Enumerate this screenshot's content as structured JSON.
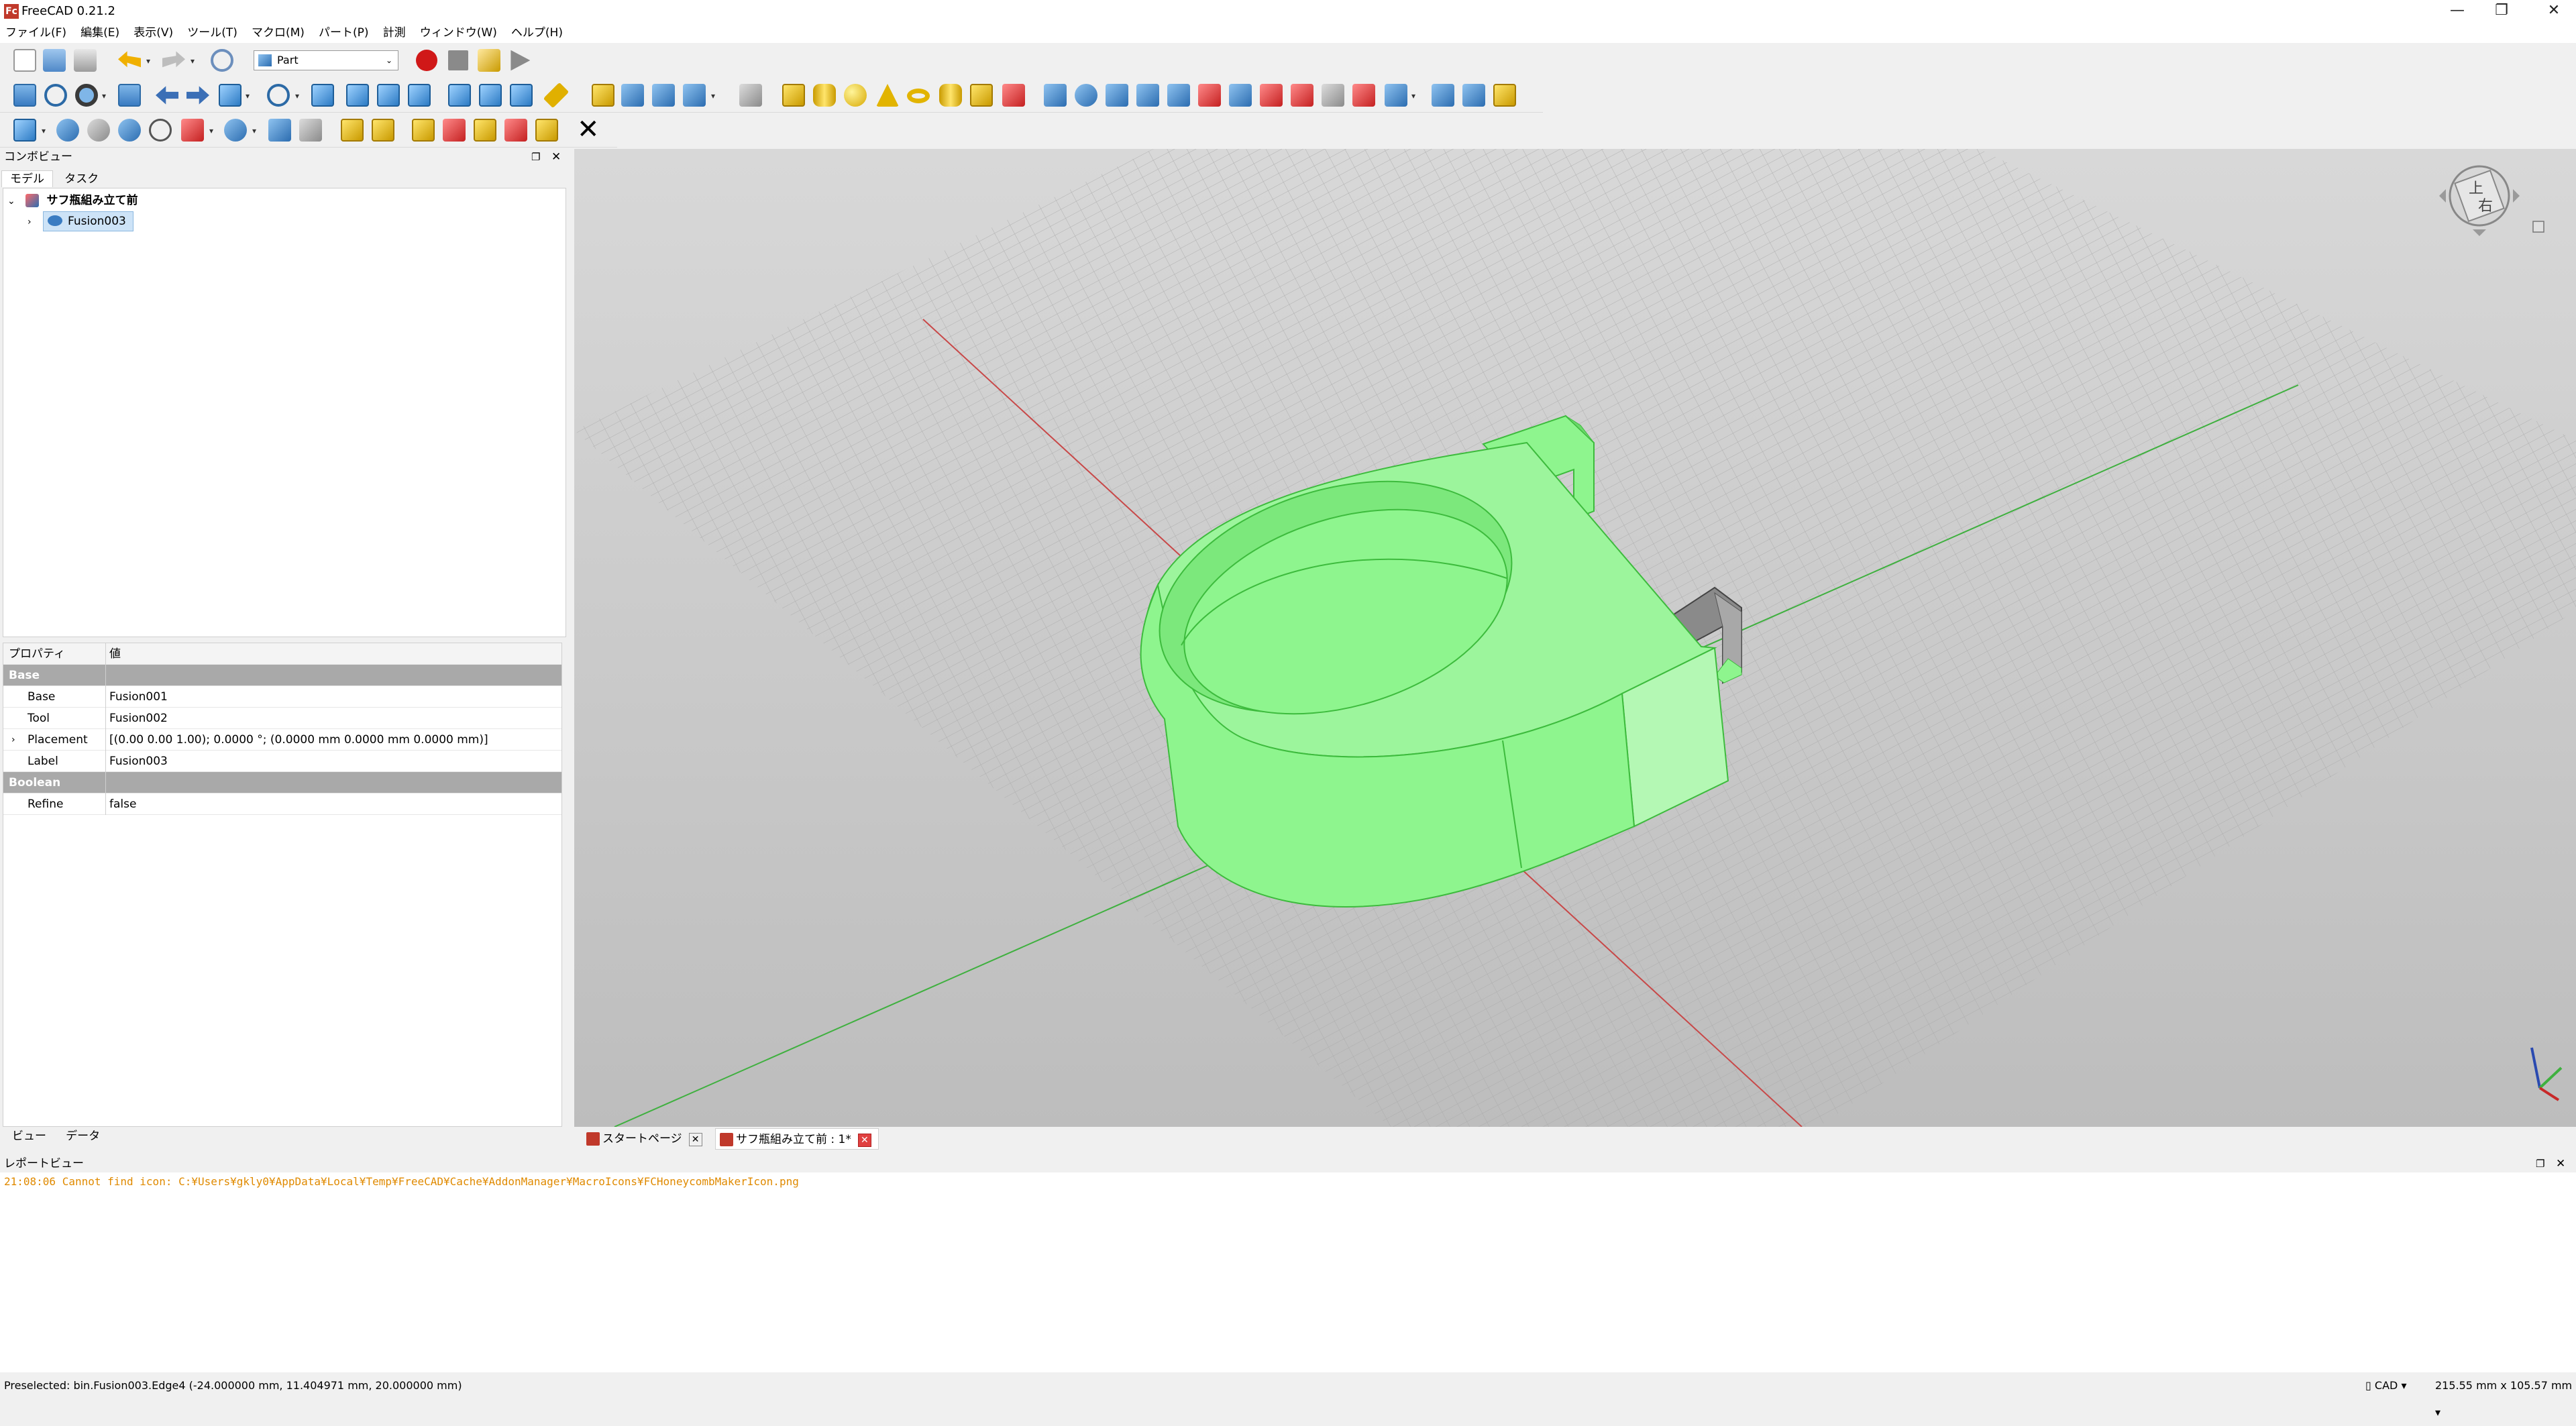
{
  "app": {
    "title": "FreeCAD 0.21.2",
    "logo_text": "Fc",
    "window_buttons": {
      "minimize": "—",
      "restore": "❐",
      "close": "✕"
    }
  },
  "menu": [
    "ファイル(F)",
    "編集(E)",
    "表示(V)",
    "ツール(T)",
    "マクロ(M)",
    "パート(P)",
    "計測",
    "ウィンドウ(W)",
    "ヘルプ(H)"
  ],
  "toolbar": {
    "workbench": "Part",
    "icons": [
      "new-file-icon",
      "open-icon",
      "save-icon",
      "undo-icon",
      "redo-icon",
      "refresh-icon",
      "record-macro-icon",
      "stop-macro-icon",
      "macros-icon",
      "execute-macro-icon",
      "fit-all-icon",
      "fit-selection-icon",
      "draw-style-icon",
      "bounding-box-icon",
      "back-icon",
      "forward-icon",
      "std-views-icon",
      "zoom-icon",
      "isometric-icon",
      "front-icon",
      "top-icon",
      "right-icon",
      "rear-icon",
      "bottom-icon",
      "left-icon",
      "measure-icon"
    ]
  },
  "combo": {
    "header": "コンボビュー",
    "tabs": [
      "モデル",
      "タスク"
    ],
    "tree": {
      "document": "サフ瓶組み立て前",
      "object": "Fusion003"
    },
    "properties": {
      "header_key": "プロパティ",
      "header_value": "値",
      "groups": [
        {
          "name": "Base",
          "rows": [
            {
              "key": "Base",
              "value": "Fusion001"
            },
            {
              "key": "Tool",
              "value": "Fusion002"
            },
            {
              "key": "Placement",
              "value": "[(0.00 0.00 1.00); 0.0000 °; (0.0000 mm  0.0000 mm  0.0000 mm)]"
            },
            {
              "key": "Label",
              "value": "Fusion003"
            }
          ]
        },
        {
          "name": "Boolean",
          "rows": [
            {
              "key": "Refine",
              "value": "false"
            }
          ]
        }
      ]
    },
    "bottom_tabs": [
      "ビュー",
      "データ"
    ]
  },
  "navcube": {
    "top_label": "上",
    "right_label": "右"
  },
  "doc_tabs": [
    {
      "label": "スタートページ"
    },
    {
      "label": "サフ瓶組み立て前 : 1*"
    }
  ],
  "report": {
    "header": "レポートビュー",
    "message": "21:08:06  Cannot find icon: C:¥Users¥gkly0¥AppData¥Local¥Temp¥FreeCAD¥Cache¥AddonManager¥MacroIcons¥FCHoneycombMakerIcon.png"
  },
  "status": {
    "preselected": "Preselected: bin.Fusion003.Edge4 (-24.000000 mm, 11.404971 mm, 20.000000 mm)",
    "nav_style": "CAD",
    "dimensions": "215.55 mm x 105.57 mm"
  },
  "colors": {
    "model_green": "#8ef58e",
    "model_edge": "#3dbb3d",
    "axis_red": "#c84848",
    "axis_green": "#3fb03f"
  }
}
